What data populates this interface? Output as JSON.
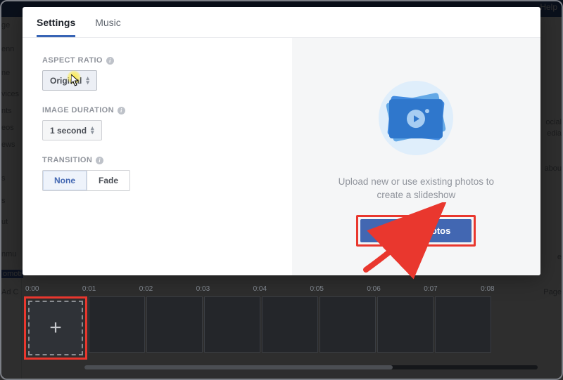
{
  "bg": {
    "help": "Help",
    "left": [
      "ge",
      "enn",
      "ne",
      "vices",
      "nts",
      "eos",
      "ews",
      "s",
      "s",
      "ut",
      "nmu",
      "omoti",
      "Ad C"
    ],
    "right": [
      "ocial",
      "edia",
      "abou",
      "e",
      "Page"
    ]
  },
  "tabs": {
    "settings": "Settings",
    "music": "Music"
  },
  "aspect": {
    "label": "ASPECT RATIO",
    "value": "Original"
  },
  "duration": {
    "label": "IMAGE DURATION",
    "value": "1 second"
  },
  "transition": {
    "label": "TRANSITION",
    "none": "None",
    "fade": "Fade"
  },
  "upload": {
    "text": "Upload new or use existing photos to create a slideshow",
    "button": "Add Photos"
  },
  "timeline": {
    "ticks": [
      "0:00",
      "0:01",
      "0:02",
      "0:03",
      "0:04",
      "0:05",
      "0:06",
      "0:07",
      "0:08"
    ]
  }
}
